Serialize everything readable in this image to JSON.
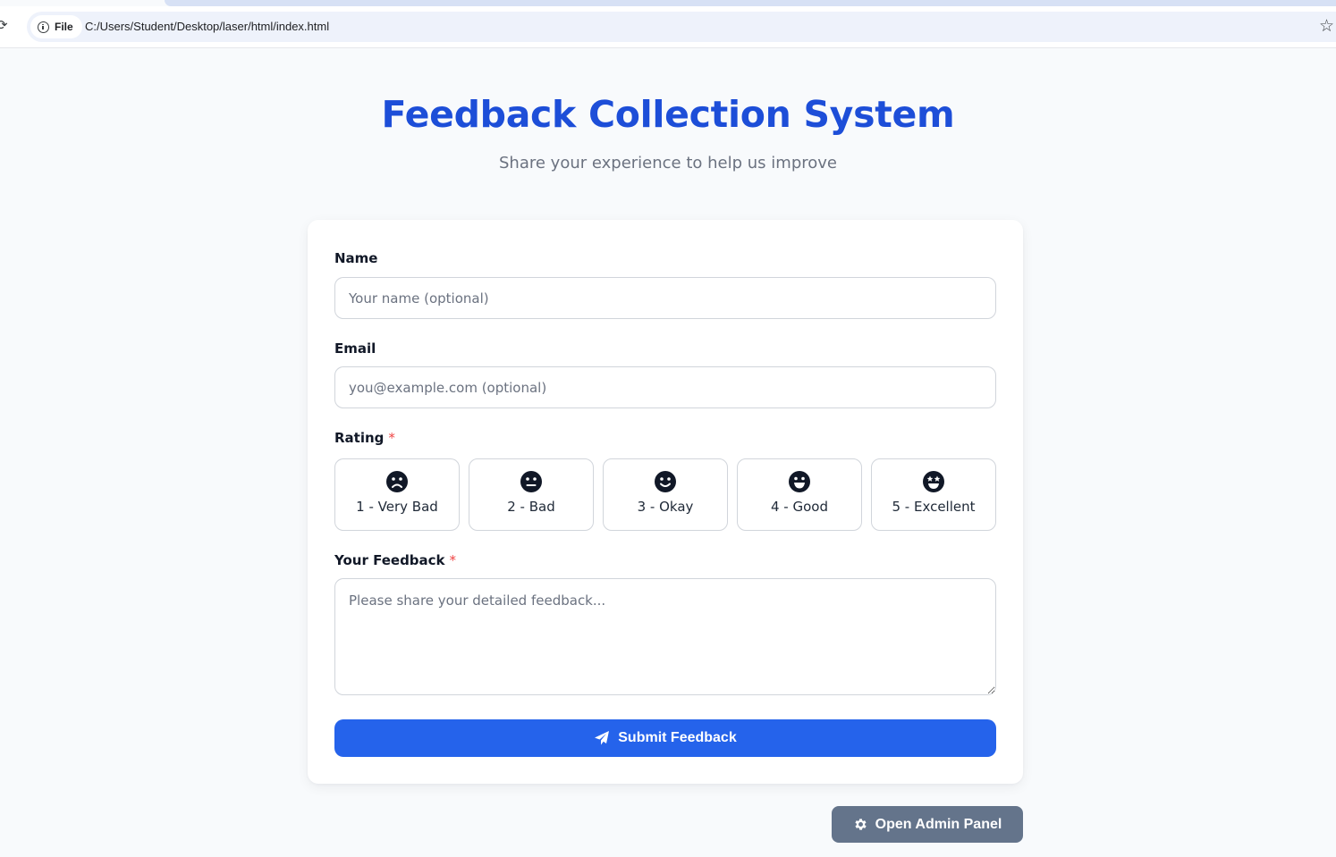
{
  "browser": {
    "reload_glyph": "⟳",
    "site_chip_label": "File",
    "url": "C:/Users/Student/Desktop/laser/html/index.html",
    "star_glyph": "☆"
  },
  "header": {
    "title": "Feedback Collection System",
    "subtitle": "Share your experience to help us improve"
  },
  "form": {
    "name": {
      "label": "Name",
      "placeholder": "Your name (optional)"
    },
    "email": {
      "label": "Email",
      "placeholder": "you@example.com (optional)"
    },
    "rating": {
      "label": "Rating",
      "required_mark": "*",
      "options": [
        {
          "label": "1 - Very Bad",
          "icon": "frown-face-icon"
        },
        {
          "label": "2 - Bad",
          "icon": "neutral-face-icon"
        },
        {
          "label": "3 - Okay",
          "icon": "smile-face-icon"
        },
        {
          "label": "4 - Good",
          "icon": "grin-face-icon"
        },
        {
          "label": "5 - Excellent",
          "icon": "star-eyes-face-icon"
        }
      ]
    },
    "feedback": {
      "label": "Your Feedback",
      "required_mark": "*",
      "placeholder": "Please share your detailed feedback..."
    },
    "submit_label": "Submit Feedback",
    "submit_icon": "paper-plane-icon"
  },
  "admin": {
    "label": "Open Admin Panel",
    "icon": "gear-icon"
  },
  "colors": {
    "accent": "#2563eb",
    "title": "#1d4ed8",
    "required": "#ef4444",
    "admin_button": "#64748b"
  }
}
